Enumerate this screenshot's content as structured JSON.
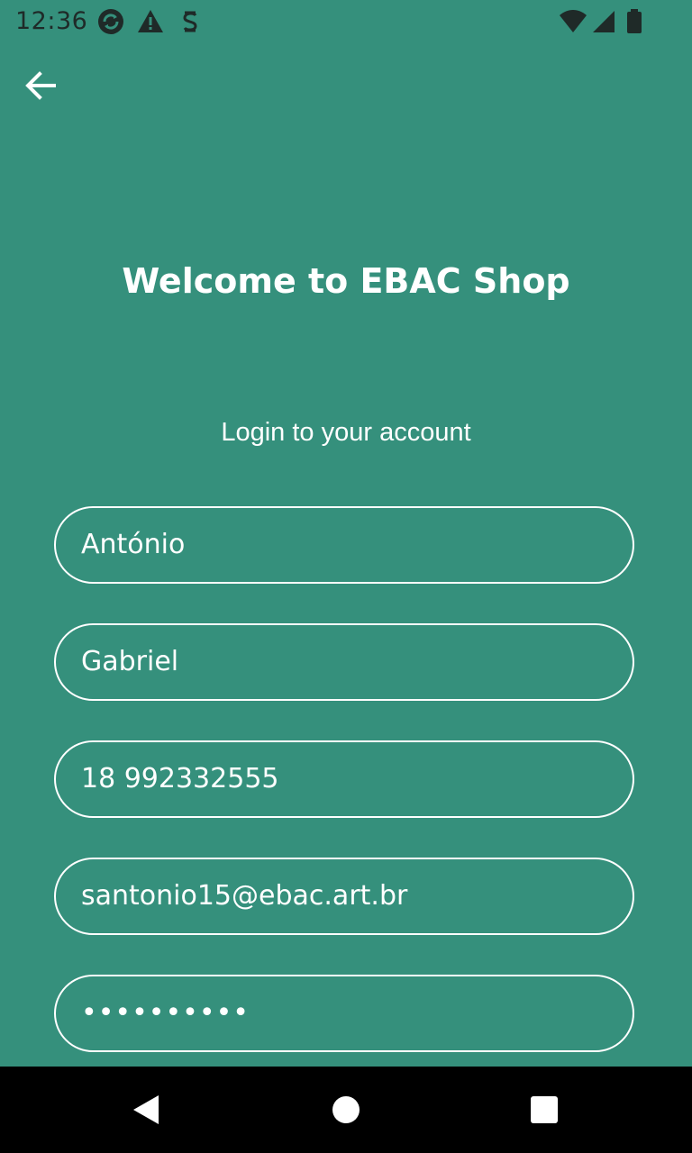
{
  "status_bar": {
    "time": "12:36",
    "left_icons": [
      "sync-icon",
      "warning-icon",
      "sim-icon"
    ],
    "right_icons": [
      "wifi-icon",
      "signal-icon",
      "battery-icon"
    ]
  },
  "header": {
    "back_icon": "arrow-left-icon"
  },
  "main": {
    "title": "Welcome to EBAC Shop",
    "subtitle": "Login to your account"
  },
  "form": {
    "first_name": "António",
    "last_name": " Gabriel",
    "phone": "18 992332555",
    "email": "santonio15@ebac.art.br",
    "password_masked": "••••••••••"
  },
  "nav_bar": {
    "icons": [
      "back-triangle-icon",
      "home-circle-icon",
      "recents-square-icon"
    ]
  },
  "colors": {
    "background": "#35907c",
    "text": "#ffffff",
    "nav_background": "#000000"
  }
}
